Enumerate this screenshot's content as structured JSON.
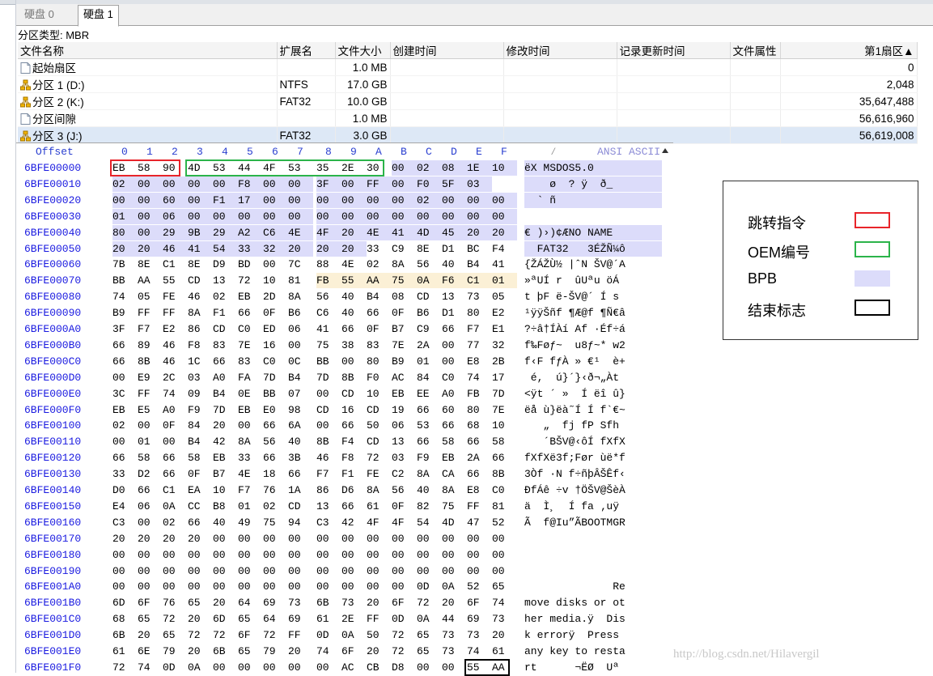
{
  "tabs": [
    {
      "label": "硬盘 0",
      "active": false
    },
    {
      "label": "硬盘 1",
      "active": true
    }
  ],
  "partition_type_label": "分区类型: MBR",
  "table": {
    "columns": [
      "文件名称",
      "扩展名",
      "文件大小",
      "创建时间",
      "修改时间",
      "记录更新时间",
      "文件属性",
      "第1扇区▲"
    ],
    "rows": [
      {
        "icon": "file-icon",
        "name": "起始扇区",
        "ext": "",
        "size": "1.0 MB",
        "first_sector": "0",
        "selected": false
      },
      {
        "icon": "partition-icon",
        "name": "分区 1 (D:)",
        "ext": "NTFS",
        "size": "17.0 GB",
        "first_sector": "2,048",
        "selected": false
      },
      {
        "icon": "partition-icon",
        "name": "分区 2 (K:)",
        "ext": "FAT32",
        "size": "10.0 GB",
        "first_sector": "35,647,488",
        "selected": false
      },
      {
        "icon": "file-icon",
        "name": "分区间隙",
        "ext": "",
        "size": "1.0 MB",
        "first_sector": "56,616,960",
        "selected": false
      },
      {
        "icon": "partition-icon",
        "name": "分区 3 (J:)",
        "ext": "FAT32",
        "size": "3.0 GB",
        "first_sector": "56,619,008",
        "selected": true
      }
    ]
  },
  "hex": {
    "header_offset": "Offset",
    "header_cols": [
      "0",
      "1",
      "2",
      "3",
      "4",
      "5",
      "6",
      "7",
      "8",
      "9",
      "A",
      "B",
      "C",
      "D",
      "E",
      "F"
    ],
    "header_ascii": "ANSI ASCII",
    "rows": [
      {
        "off": "6BFE00000",
        "bytes": "EB 58 90 4D 53 44 4F 53 35 2E 30 00 02 08 1E 10",
        "ascii": "ëX MSDOS5.0"
      },
      {
        "off": "6BFE00010",
        "bytes": "02 00 00 00 00 F8 00 00 3F 00 FF 00 F0 5F 03",
        "ascii": "    ø  ? ÿ  ð_"
      },
      {
        "off": "6BFE00020",
        "bytes": "00 00 60 00 F1 17 00 00 00 00 00 00 02 00 00 00",
        "ascii": "  ` ñ"
      },
      {
        "off": "6BFE00030",
        "bytes": "01 00 06 00 00 00 00 00 00 00 00 00 00 00 00 00",
        "ascii": ""
      },
      {
        "off": "6BFE00040",
        "bytes": "80 00 29 9B 29 A2 C6 4E 4F 20 4E 41 4D 45 20 20",
        "ascii": "€ )›)¢ÆNO NAME"
      },
      {
        "off": "6BFE00050",
        "bytes": "20 20 46 41 54 33 32 20 20 20 33 C9 8E D1 BC F4",
        "ascii": "  FAT32   3ÉŽÑ¼ô"
      },
      {
        "off": "6BFE00060",
        "bytes": "7B 8E C1 8E D9 BD 00 7C 88 4E 02 8A 56 40 B4 41",
        "ascii": "{ŽÁŽÙ½ |ˆN ŠV@´A"
      },
      {
        "off": "6BFE00070",
        "bytes": "BB AA 55 CD 13 72 10 81 FB 55 AA 75 0A F6 C1 01",
        "ascii": "»ªUÍ r  ûUªu öÁ"
      },
      {
        "off": "6BFE00080",
        "bytes": "74 05 FE 46 02 EB 2D 8A 56 40 B4 08 CD 13 73 05",
        "ascii": "t þF ë-ŠV@´ Í s"
      },
      {
        "off": "6BFE00090",
        "bytes": "B9 FF FF 8A F1 66 0F B6 C6 40 66 0F B6 D1 80 E2",
        "ascii": "¹ÿÿŠñf ¶Æ@f ¶Ñ€â"
      },
      {
        "off": "6BFE000A0",
        "bytes": "3F F7 E2 86 CD C0 ED 06 41 66 0F B7 C9 66 F7 E1",
        "ascii": "?÷â†ÍÀí Af ·Éf÷á"
      },
      {
        "off": "6BFE000B0",
        "bytes": "66 89 46 F8 83 7E 16 00 75 38 83 7E 2A 00 77 32",
        "ascii": "f‰Føƒ~  u8ƒ~* w2"
      },
      {
        "off": "6BFE000C0",
        "bytes": "66 8B 46 1C 66 83 C0 0C BB 00 80 B9 01 00 E8 2B",
        "ascii": "f‹F fƒÀ » €¹  è+"
      },
      {
        "off": "6BFE000D0",
        "bytes": "00 E9 2C 03 A0 FA 7D B4 7D 8B F0 AC 84 C0 74 17",
        "ascii": " é,  ú}´}‹ð¬„Àt"
      },
      {
        "off": "6BFE000E0",
        "bytes": "3C FF 74 09 B4 0E BB 07 00 CD 10 EB EE A0 FB 7D",
        "ascii": "<ÿt ´ »  Í ëî û}"
      },
      {
        "off": "6BFE000F0",
        "bytes": "EB E5 A0 F9 7D EB E0 98 CD 16 CD 19 66 60 80 7E",
        "ascii": "ëå ù}ëà˜Í Í f`€~"
      },
      {
        "off": "6BFE00100",
        "bytes": "02 00 0F 84 20 00 66 6A 00 66 50 06 53 66 68 10",
        "ascii": "   „  fj fP Sfh"
      },
      {
        "off": "6BFE00110",
        "bytes": "00 01 00 B4 42 8A 56 40 8B F4 CD 13 66 58 66 58",
        "ascii": "   ´BŠV@‹ôÍ fXfX"
      },
      {
        "off": "6BFE00120",
        "bytes": "66 58 66 58 EB 33 66 3B 46 F8 72 03 F9 EB 2A 66",
        "ascii": "fXfXë3f;Før ùë*f"
      },
      {
        "off": "6BFE00130",
        "bytes": "33 D2 66 0F B7 4E 18 66 F7 F1 FE C2 8A CA 66 8B",
        "ascii": "3Òf ·N f÷ñþÂŠÊf‹"
      },
      {
        "off": "6BFE00140",
        "bytes": "D0 66 C1 EA 10 F7 76 1A 86 D6 8A 56 40 8A E8 C0",
        "ascii": "ÐfÁê ÷v †ÖŠV@ŠèÀ"
      },
      {
        "off": "6BFE00150",
        "bytes": "E4 06 0A CC B8 01 02 CD 13 66 61 0F 82 75 FF 81",
        "ascii": "ä  Ì¸  Í fa ‚uÿ"
      },
      {
        "off": "6BFE00160",
        "bytes": "C3 00 02 66 40 49 75 94 C3 42 4F 4F 54 4D 47 52",
        "ascii": "Ã  f@Iu”ÃBOOTMGR"
      },
      {
        "off": "6BFE00170",
        "bytes": "20 20 20 20 00 00 00 00 00 00 00 00 00 00 00 00",
        "ascii": ""
      },
      {
        "off": "6BFE00180",
        "bytes": "00 00 00 00 00 00 00 00 00 00 00 00 00 00 00 00",
        "ascii": ""
      },
      {
        "off": "6BFE00190",
        "bytes": "00 00 00 00 00 00 00 00 00 00 00 00 00 00 00 00",
        "ascii": ""
      },
      {
        "off": "6BFE001A0",
        "bytes": "00 00 00 00 00 00 00 00 00 00 00 00 0D 0A 52 65",
        "ascii": "              Re"
      },
      {
        "off": "6BFE001B0",
        "bytes": "6D 6F 76 65 20 64 69 73 6B 73 20 6F 72 20 6F 74",
        "ascii": "move disks or ot"
      },
      {
        "off": "6BFE001C0",
        "bytes": "68 65 72 20 6D 65 64 69 61 2E FF 0D 0A 44 69 73",
        "ascii": "her media.ÿ  Dis"
      },
      {
        "off": "6BFE001D0",
        "bytes": "6B 20 65 72 72 6F 72 FF 0D 0A 50 72 65 73 73 20",
        "ascii": "k errorÿ  Press"
      },
      {
        "off": "6BFE001E0",
        "bytes": "61 6E 79 20 6B 65 79 20 74 6F 20 72 65 73 74 61",
        "ascii": "any key to resta"
      },
      {
        "off": "6BFE001F0",
        "bytes": "72 74 0D 0A 00 00 00 00 00 AC CB D8 00 00 55 AA",
        "ascii": "rt      ¬ËØ  Uª"
      }
    ]
  },
  "legend": {
    "items": [
      {
        "label": "跳转指令",
        "color": "#e8242a",
        "kind": "outline"
      },
      {
        "label": "OEM编号",
        "color": "#2bb44a",
        "kind": "outline"
      },
      {
        "label": "BPB",
        "color": "#dcdcfa",
        "kind": "fill"
      },
      {
        "label": "结束标志",
        "color": "#000000",
        "kind": "outline"
      }
    ]
  },
  "colors": {
    "bpb_fill": "#dcdcfa",
    "boot_hi_fill": "#fbf0d6",
    "selected_row": "#dde8f6",
    "offset_text": "#1a1ae0"
  },
  "watermark": "http://blog.csdn.net/Hilavergil"
}
